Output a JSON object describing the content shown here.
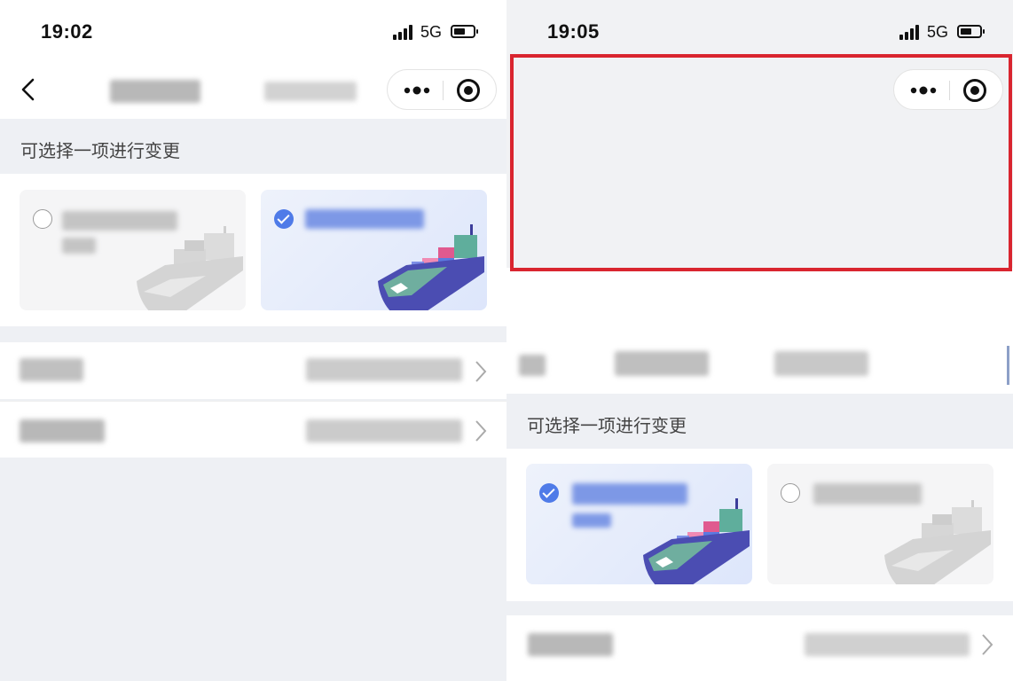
{
  "left": {
    "status": {
      "time": "19:02",
      "network": "5G"
    },
    "nav": {
      "back_icon": "chevron-left-icon",
      "more_icon": "more-dots-icon",
      "close_icon": "target-icon"
    },
    "section": {
      "label": "可选择一项进行变更"
    },
    "options": [
      {
        "selected": false,
        "illustration": "cargo-ship-icon"
      },
      {
        "selected": true,
        "illustration": "cargo-ship-icon"
      }
    ],
    "rows": [
      {
        "chevron_icon": "chevron-right-icon"
      },
      {
        "chevron_icon": "chevron-right-icon"
      }
    ]
  },
  "right": {
    "status": {
      "time": "19:05",
      "network": "5G"
    },
    "nav": {
      "more_icon": "more-dots-icon",
      "close_icon": "target-icon"
    },
    "section": {
      "label": "可选择一项进行变更"
    },
    "options": [
      {
        "selected": true,
        "illustration": "cargo-ship-icon"
      },
      {
        "selected": false,
        "illustration": "cargo-ship-icon"
      }
    ],
    "rows": [
      {
        "chevron_icon": "chevron-right-icon"
      }
    ],
    "highlight": {
      "color": "#d9252f"
    }
  },
  "colors": {
    "accent": "#4f7be8",
    "page_bg": "#eef0f4",
    "highlight": "#d9252f"
  }
}
